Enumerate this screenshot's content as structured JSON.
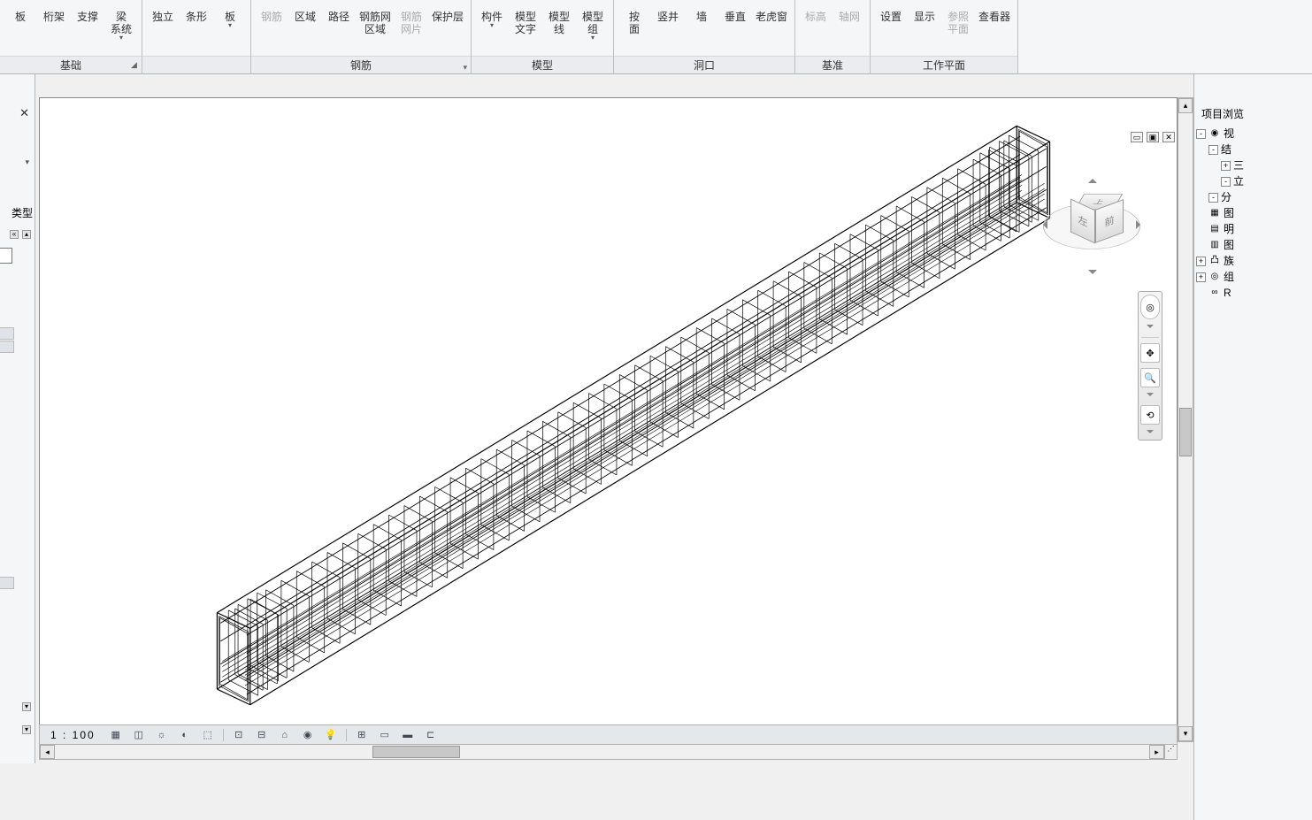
{
  "ribbon": {
    "groups": [
      {
        "name": "基础",
        "launcher": true,
        "items": [
          {
            "label": "板",
            "icon": "slab"
          },
          {
            "label": "桁架",
            "icon": "truss"
          },
          {
            "label": "支撑",
            "icon": "brace"
          },
          {
            "label": "梁\n系统",
            "icon": "beam-system",
            "dropdown": true
          }
        ]
      },
      {
        "name": "",
        "items": [
          {
            "label": "独立",
            "icon": "isolated"
          },
          {
            "label": "条形",
            "icon": "strip"
          },
          {
            "label": "板",
            "icon": "slab2",
            "dropdown": true
          }
        ]
      },
      {
        "name": "钢筋",
        "dropdown": true,
        "items": [
          {
            "label": "钢筋",
            "icon": "rebar",
            "disabled": true
          },
          {
            "label": "区域",
            "icon": "area"
          },
          {
            "label": "路径",
            "icon": "path"
          },
          {
            "label": "钢筋网\n区域",
            "icon": "fabric-area"
          },
          {
            "label": "钢筋\n网片",
            "icon": "fabric-sheet",
            "disabled": true
          },
          {
            "label": "保护层",
            "icon": "cover"
          }
        ]
      },
      {
        "name": "模型",
        "items": [
          {
            "label": "构件",
            "icon": "component",
            "dropdown": true
          },
          {
            "label": "模型\n文字",
            "icon": "model-text"
          },
          {
            "label": "模型\n线",
            "icon": "model-line"
          },
          {
            "label": "模型\n组",
            "icon": "model-group",
            "dropdown": true
          }
        ]
      },
      {
        "name": "洞口",
        "items": [
          {
            "label": "按\n面",
            "icon": "by-face"
          },
          {
            "label": "竖井",
            "icon": "shaft"
          },
          {
            "label": "墙",
            "icon": "wall-opening"
          },
          {
            "label": "垂直",
            "icon": "vertical"
          },
          {
            "label": "老虎窗",
            "icon": "dormer"
          }
        ]
      },
      {
        "name": "基准",
        "items": [
          {
            "label": "标高",
            "icon": "level",
            "disabled": true
          },
          {
            "label": "轴网",
            "icon": "grid",
            "disabled": true
          }
        ]
      },
      {
        "name": "工作平面",
        "items": [
          {
            "label": "设置",
            "icon": "set"
          },
          {
            "label": "显示",
            "icon": "show"
          },
          {
            "label": "参照\n平面",
            "icon": "ref-plane",
            "disabled": true
          },
          {
            "label": "查看器",
            "icon": "viewer"
          }
        ]
      }
    ]
  },
  "left": {
    "header_fragment": "类型"
  },
  "view": {
    "scale": "1 : 100",
    "cube": {
      "top": "上",
      "left": "左",
      "front": "前"
    },
    "ctrl": {
      "min": "▭",
      "max": "▣",
      "close": "✕"
    }
  },
  "browser": {
    "title": "项目浏览",
    "nodes": [
      {
        "depth": 0,
        "toggle": "-",
        "icon": "◉",
        "label": "视"
      },
      {
        "depth": 1,
        "toggle": "-",
        "icon": "",
        "label": "结"
      },
      {
        "depth": 2,
        "toggle": "",
        "icon": "",
        "label": ""
      },
      {
        "depth": 2,
        "toggle": "",
        "icon": "",
        "label": ""
      },
      {
        "depth": 2,
        "toggle": "+",
        "icon": "",
        "label": "三"
      },
      {
        "depth": 2,
        "toggle": "-",
        "icon": "",
        "label": "立"
      },
      {
        "depth": 3,
        "toggle": "",
        "icon": "",
        "label": ""
      },
      {
        "depth": 3,
        "toggle": "",
        "icon": "",
        "label": ""
      },
      {
        "depth": 3,
        "toggle": "",
        "icon": "",
        "label": ""
      },
      {
        "depth": 3,
        "toggle": "",
        "icon": "",
        "label": ""
      },
      {
        "depth": 1,
        "toggle": "-",
        "icon": "",
        "label": "分"
      },
      {
        "depth": 2,
        "toggle": "",
        "icon": "",
        "label": ""
      },
      {
        "depth": 2,
        "toggle": "",
        "icon": "",
        "label": ""
      },
      {
        "depth": 0,
        "toggle": "",
        "icon": "▦",
        "label": "图"
      },
      {
        "depth": 0,
        "toggle": "",
        "icon": "▤",
        "label": "明"
      },
      {
        "depth": 0,
        "toggle": "",
        "icon": "▥",
        "label": "图"
      },
      {
        "depth": 0,
        "toggle": "+",
        "icon": "凸",
        "label": "族"
      },
      {
        "depth": 0,
        "toggle": "+",
        "icon": "◎",
        "label": "组"
      },
      {
        "depth": 0,
        "toggle": "",
        "icon": "∞",
        "label": "R"
      }
    ]
  }
}
